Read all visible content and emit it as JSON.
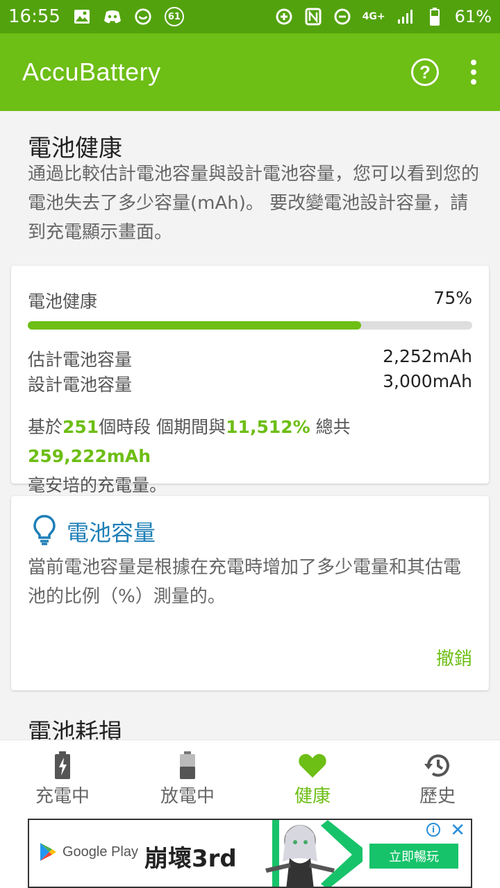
{
  "statusbar": {
    "time": "16:55",
    "notif_count": "61",
    "network": "4G+",
    "battery_percent": "61%"
  },
  "appbar": {
    "title": "AccuBattery"
  },
  "health": {
    "title": "電池健康",
    "description": "通過比較估計電池容量與設計電池容量，您可以看到您的電池失去了多少容量(mAh)。 要改變電池設計容量，請到充電顯示畫面。",
    "card": {
      "label": "電池健康",
      "percent": "75%",
      "progress": 0.75,
      "estimated_label": "估計電池容量",
      "estimated_value": "2,252mAh",
      "design_label": "設計電池容量",
      "design_value": "3,000mAh",
      "sessions_prefix": "基於",
      "sessions_count": "251",
      "sessions_mid1": "個時段 個期間與",
      "sessions_percent": "11,512%",
      "sessions_mid2": " 總共",
      "sessions_total": "259,222mAh",
      "sessions_suffix": "毫安培的充電量。"
    }
  },
  "tip": {
    "title": "電池容量",
    "description": "當前電池容量是根據在充電時增加了多少電量和其估電池的比例（%）測量的。",
    "dismiss": "撤銷"
  },
  "wear": {
    "title": "電池耗損"
  },
  "nav": [
    {
      "label": "充電中",
      "icon": "battery-charging-icon"
    },
    {
      "label": "放電中",
      "icon": "battery-discharging-icon"
    },
    {
      "label": "健康",
      "icon": "heart-icon"
    },
    {
      "label": "歷史",
      "icon": "history-icon"
    }
  ],
  "ad": {
    "store": "Google Play",
    "game": "崩壞3rd",
    "cta": "立即暢玩",
    "info": "i",
    "close": "✕"
  },
  "colors": {
    "statusbar": "#52a20d",
    "appbar": "#6dbe15",
    "accent": "#6dbe15",
    "tip_title": "#1e7fb7"
  }
}
